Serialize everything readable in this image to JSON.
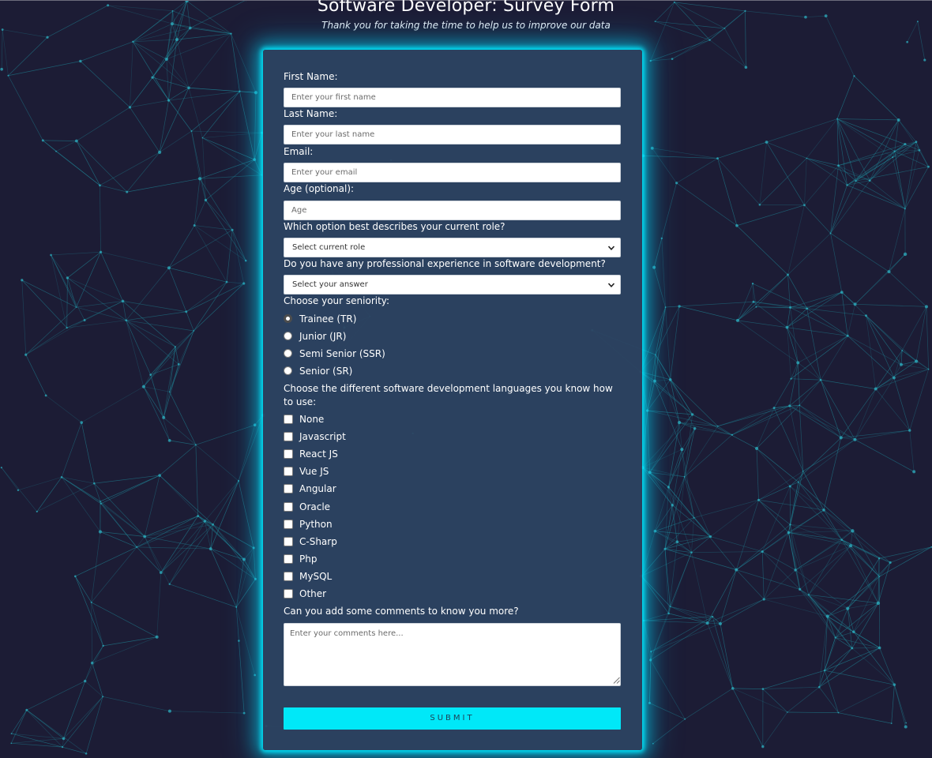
{
  "page": {
    "title": "Software Developer: Survey Form",
    "subtitle": "Thank you for taking the time to help us to improve our data"
  },
  "form": {
    "first_name": {
      "label": "First Name:",
      "placeholder": "Enter your first name"
    },
    "last_name": {
      "label": "Last Name:",
      "placeholder": "Enter your last name"
    },
    "email": {
      "label": "Email:",
      "placeholder": "Enter your email"
    },
    "age": {
      "label": "Age (optional):",
      "placeholder": "Age"
    },
    "role": {
      "label": "Which option best describes your current role?",
      "selected": "Select current role"
    },
    "experience": {
      "label": "Do you have any professional experience in software development?",
      "selected": "Select your answer"
    },
    "seniority": {
      "label": "Choose your seniority:",
      "options": [
        "Trainee (TR)",
        "Junior (JR)",
        "Semi Senior (SSR)",
        "Senior (SR)"
      ],
      "checked_index": 0
    },
    "languages": {
      "label": "Choose the different software development languages you know how to use:",
      "options": [
        "None",
        "Javascript",
        "React JS",
        "Vue JS",
        "Angular",
        "Oracle",
        "Python",
        "C-Sharp",
        "Php",
        "MySQL",
        "Other"
      ]
    },
    "comments": {
      "label": "Can you add some comments to know you more?",
      "placeholder": "Enter your comments here..."
    },
    "submit_label": "SUBMIT"
  },
  "colors": {
    "background": "#1c1c35",
    "card": "#2d4462",
    "accent": "#00e8f8",
    "network_lines": "#1f8a9a"
  },
  "icons": {
    "select_arrow": "chevron-down-icon",
    "textarea_resize": "resize-grip-icon"
  }
}
